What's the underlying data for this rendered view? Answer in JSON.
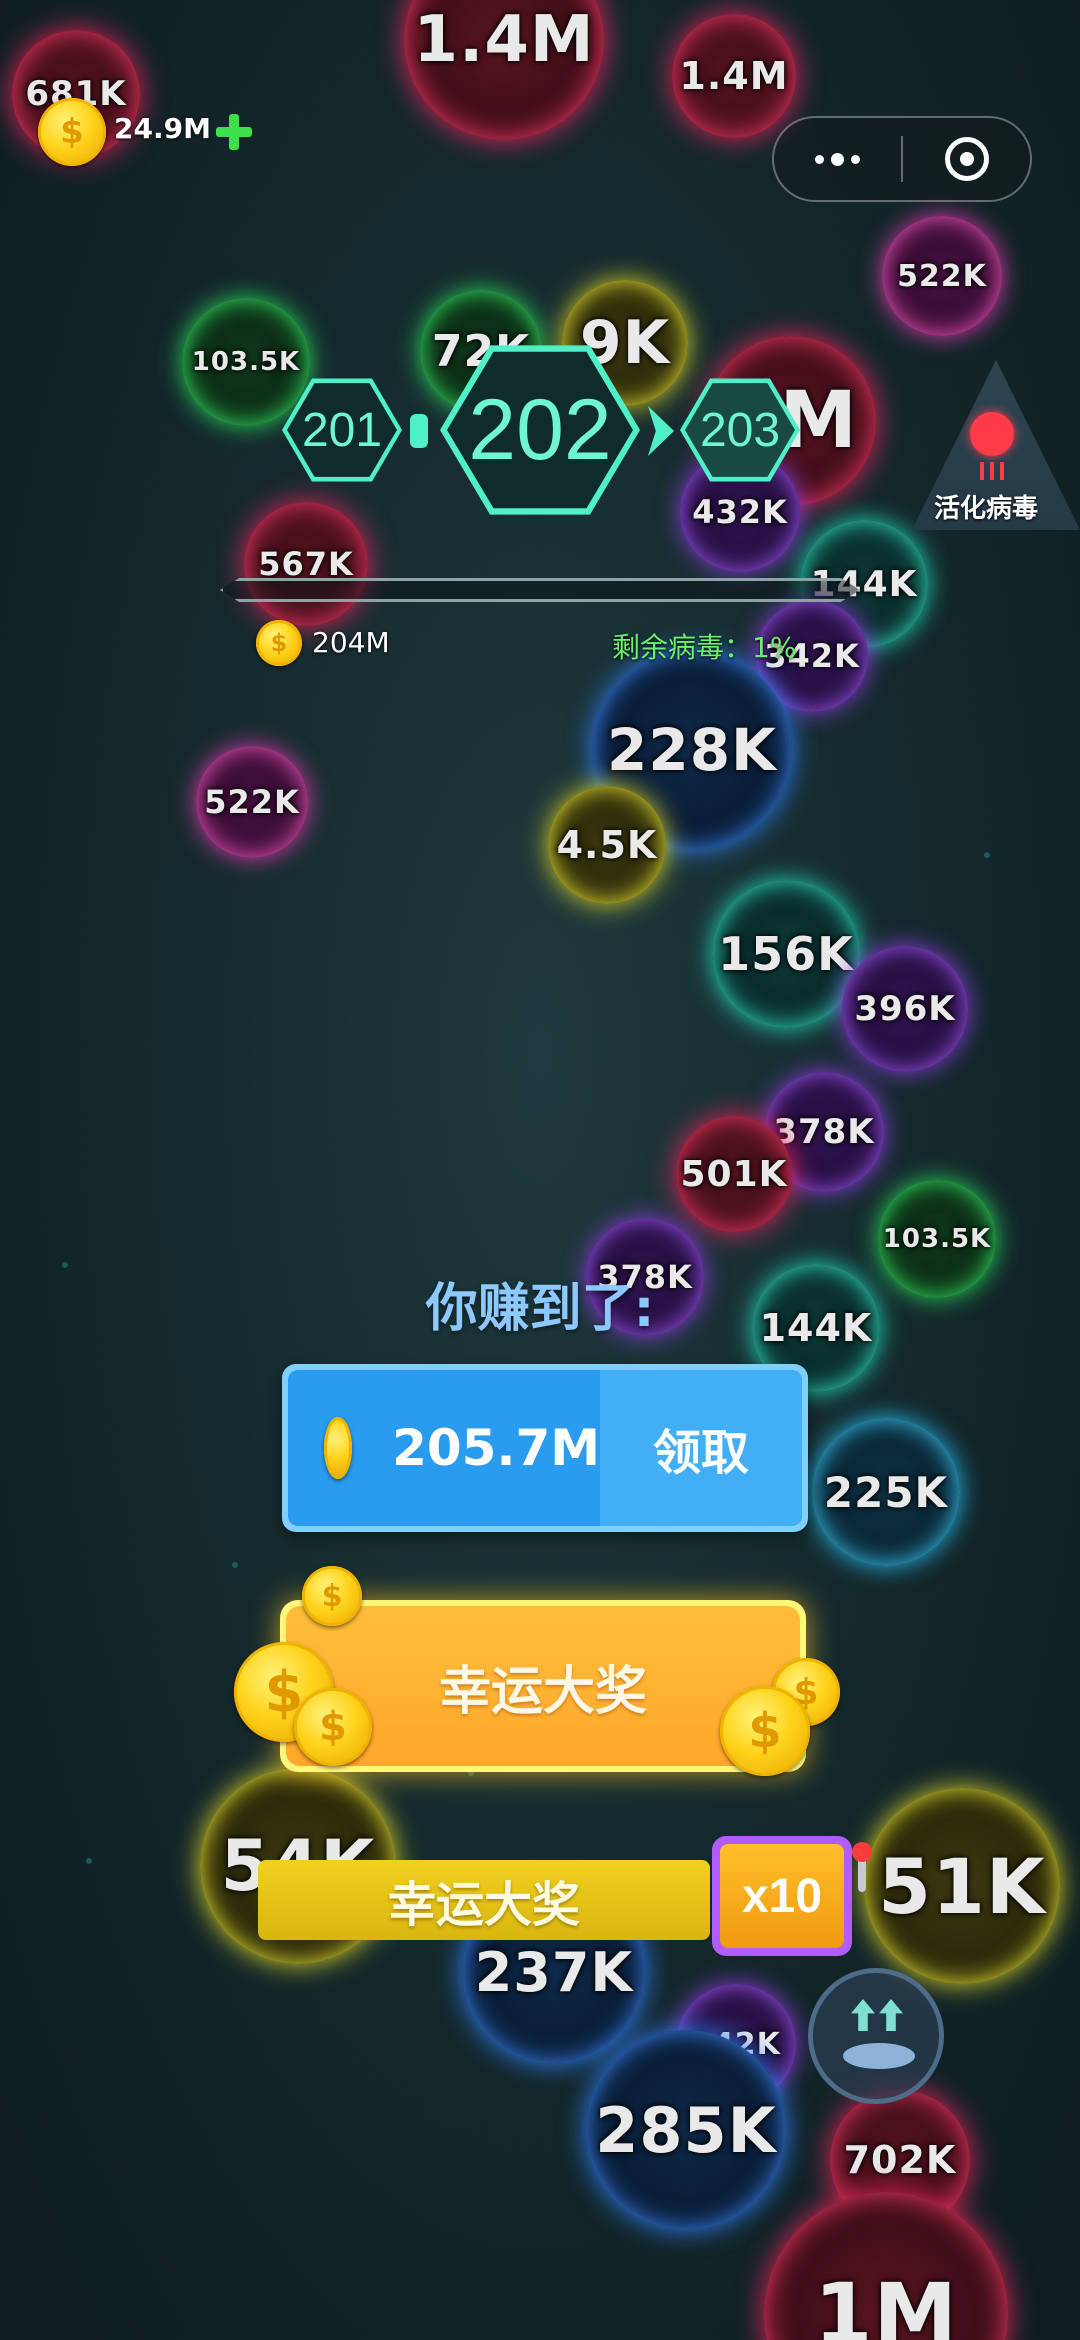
{
  "top_bar": {
    "currency": "24.9M"
  },
  "viruses": [
    {
      "value": "681K",
      "color": "#e2245a"
    },
    {
      "value": "1.4M",
      "color": "#e2245a"
    },
    {
      "value": "1.4M",
      "color": "#e2245a"
    },
    {
      "value": "522K",
      "color": "#d43ba9"
    },
    {
      "value": "103.5K",
      "color": "#2bd15a"
    },
    {
      "value": "72K",
      "color": "#2bd15a"
    },
    {
      "value": "9K",
      "color": "#d6d02a"
    },
    {
      "value": "1M",
      "color": "#e2245a"
    },
    {
      "value": "432K",
      "color": "#8a3cd8"
    },
    {
      "value": "567K",
      "color": "#e2245a"
    },
    {
      "value": "144K",
      "color": "#23d1b0"
    },
    {
      "value": "342K",
      "color": "#8a3cd8"
    },
    {
      "value": "228K",
      "color": "#2f7cf0"
    },
    {
      "value": "522K",
      "color": "#d43ba9"
    },
    {
      "value": "4.5K",
      "color": "#d6d02a"
    },
    {
      "value": "156K",
      "color": "#23d1b0"
    },
    {
      "value": "396K",
      "color": "#8a3cd8"
    },
    {
      "value": "378K",
      "color": "#8a3cd8"
    },
    {
      "value": "501K",
      "color": "#e2245a"
    },
    {
      "value": "103.5K",
      "color": "#2bd15a"
    },
    {
      "value": "378K",
      "color": "#8a3cd8"
    },
    {
      "value": "144K",
      "color": "#23d1b0"
    },
    {
      "value": "225K",
      "color": "#25b6e5"
    },
    {
      "value": "54K",
      "color": "#d6d02a"
    },
    {
      "value": "51K",
      "color": "#d6d02a"
    },
    {
      "value": "237K",
      "color": "#2f7cf0"
    },
    {
      "value": "342K",
      "color": "#8a3cd8"
    },
    {
      "value": "285K",
      "color": "#2f7cf0"
    },
    {
      "value": "702K",
      "color": "#e2245a"
    },
    {
      "value": "1M",
      "color": "#e2245a"
    }
  ],
  "levels": {
    "prev": "201",
    "current": "202",
    "next": "203"
  },
  "level_reward": "204M",
  "remaining_virus": "剩余病毒：1%",
  "activate_virus_label": "活化病毒",
  "reward": {
    "title": "你赚到了:",
    "amount": "205.7M",
    "claim_label": "领取"
  },
  "lucky_prize_button": "幸运大奖",
  "lucky_prize_bar": "幸运大奖",
  "multiplier": "x10"
}
